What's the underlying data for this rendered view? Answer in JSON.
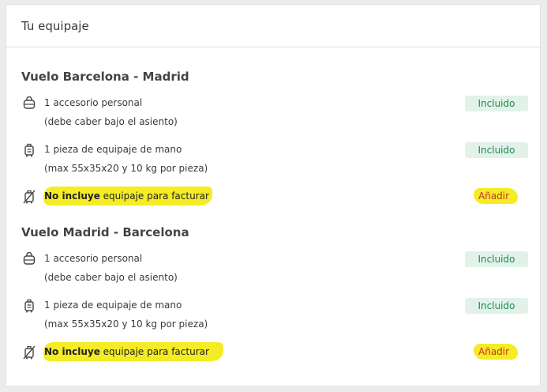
{
  "section_title": "Tu equipaje",
  "flights": [
    {
      "title": "Vuelo Barcelona - Madrid",
      "items": [
        {
          "icon": "personal-bag-icon",
          "line1": "1 accesorio personal",
          "line2": "(debe caber bajo el asiento)",
          "status": "Incluido"
        },
        {
          "icon": "cabin-luggage-icon",
          "line1": "1 pieza de equipaje de mano",
          "line2": "(max 55x35x20 y 10 kg por pieza)",
          "status": "Incluido"
        }
      ],
      "excluded": {
        "bold": "No incluye",
        "rest": " equipaje para facturar",
        "action": "Añadir"
      }
    },
    {
      "title": "Vuelo Madrid - Barcelona",
      "items": [
        {
          "icon": "personal-bag-icon",
          "line1": "1 accesorio personal",
          "line2": "(debe caber bajo el asiento)",
          "status": "Incluido"
        },
        {
          "icon": "cabin-luggage-icon",
          "line1": "1 pieza de equipaje de mano",
          "line2": "(max 55x35x20 y 10 kg por pieza)",
          "status": "Incluido"
        }
      ],
      "excluded": {
        "bold": "No incluye",
        "rest": " equipaje para facturar",
        "action": "Añadir"
      }
    }
  ],
  "colors": {
    "included_bg": "#e2f2ea",
    "included_text": "#1f8a4c",
    "highlight": "#f4ec24",
    "add_text": "#c9302c"
  }
}
